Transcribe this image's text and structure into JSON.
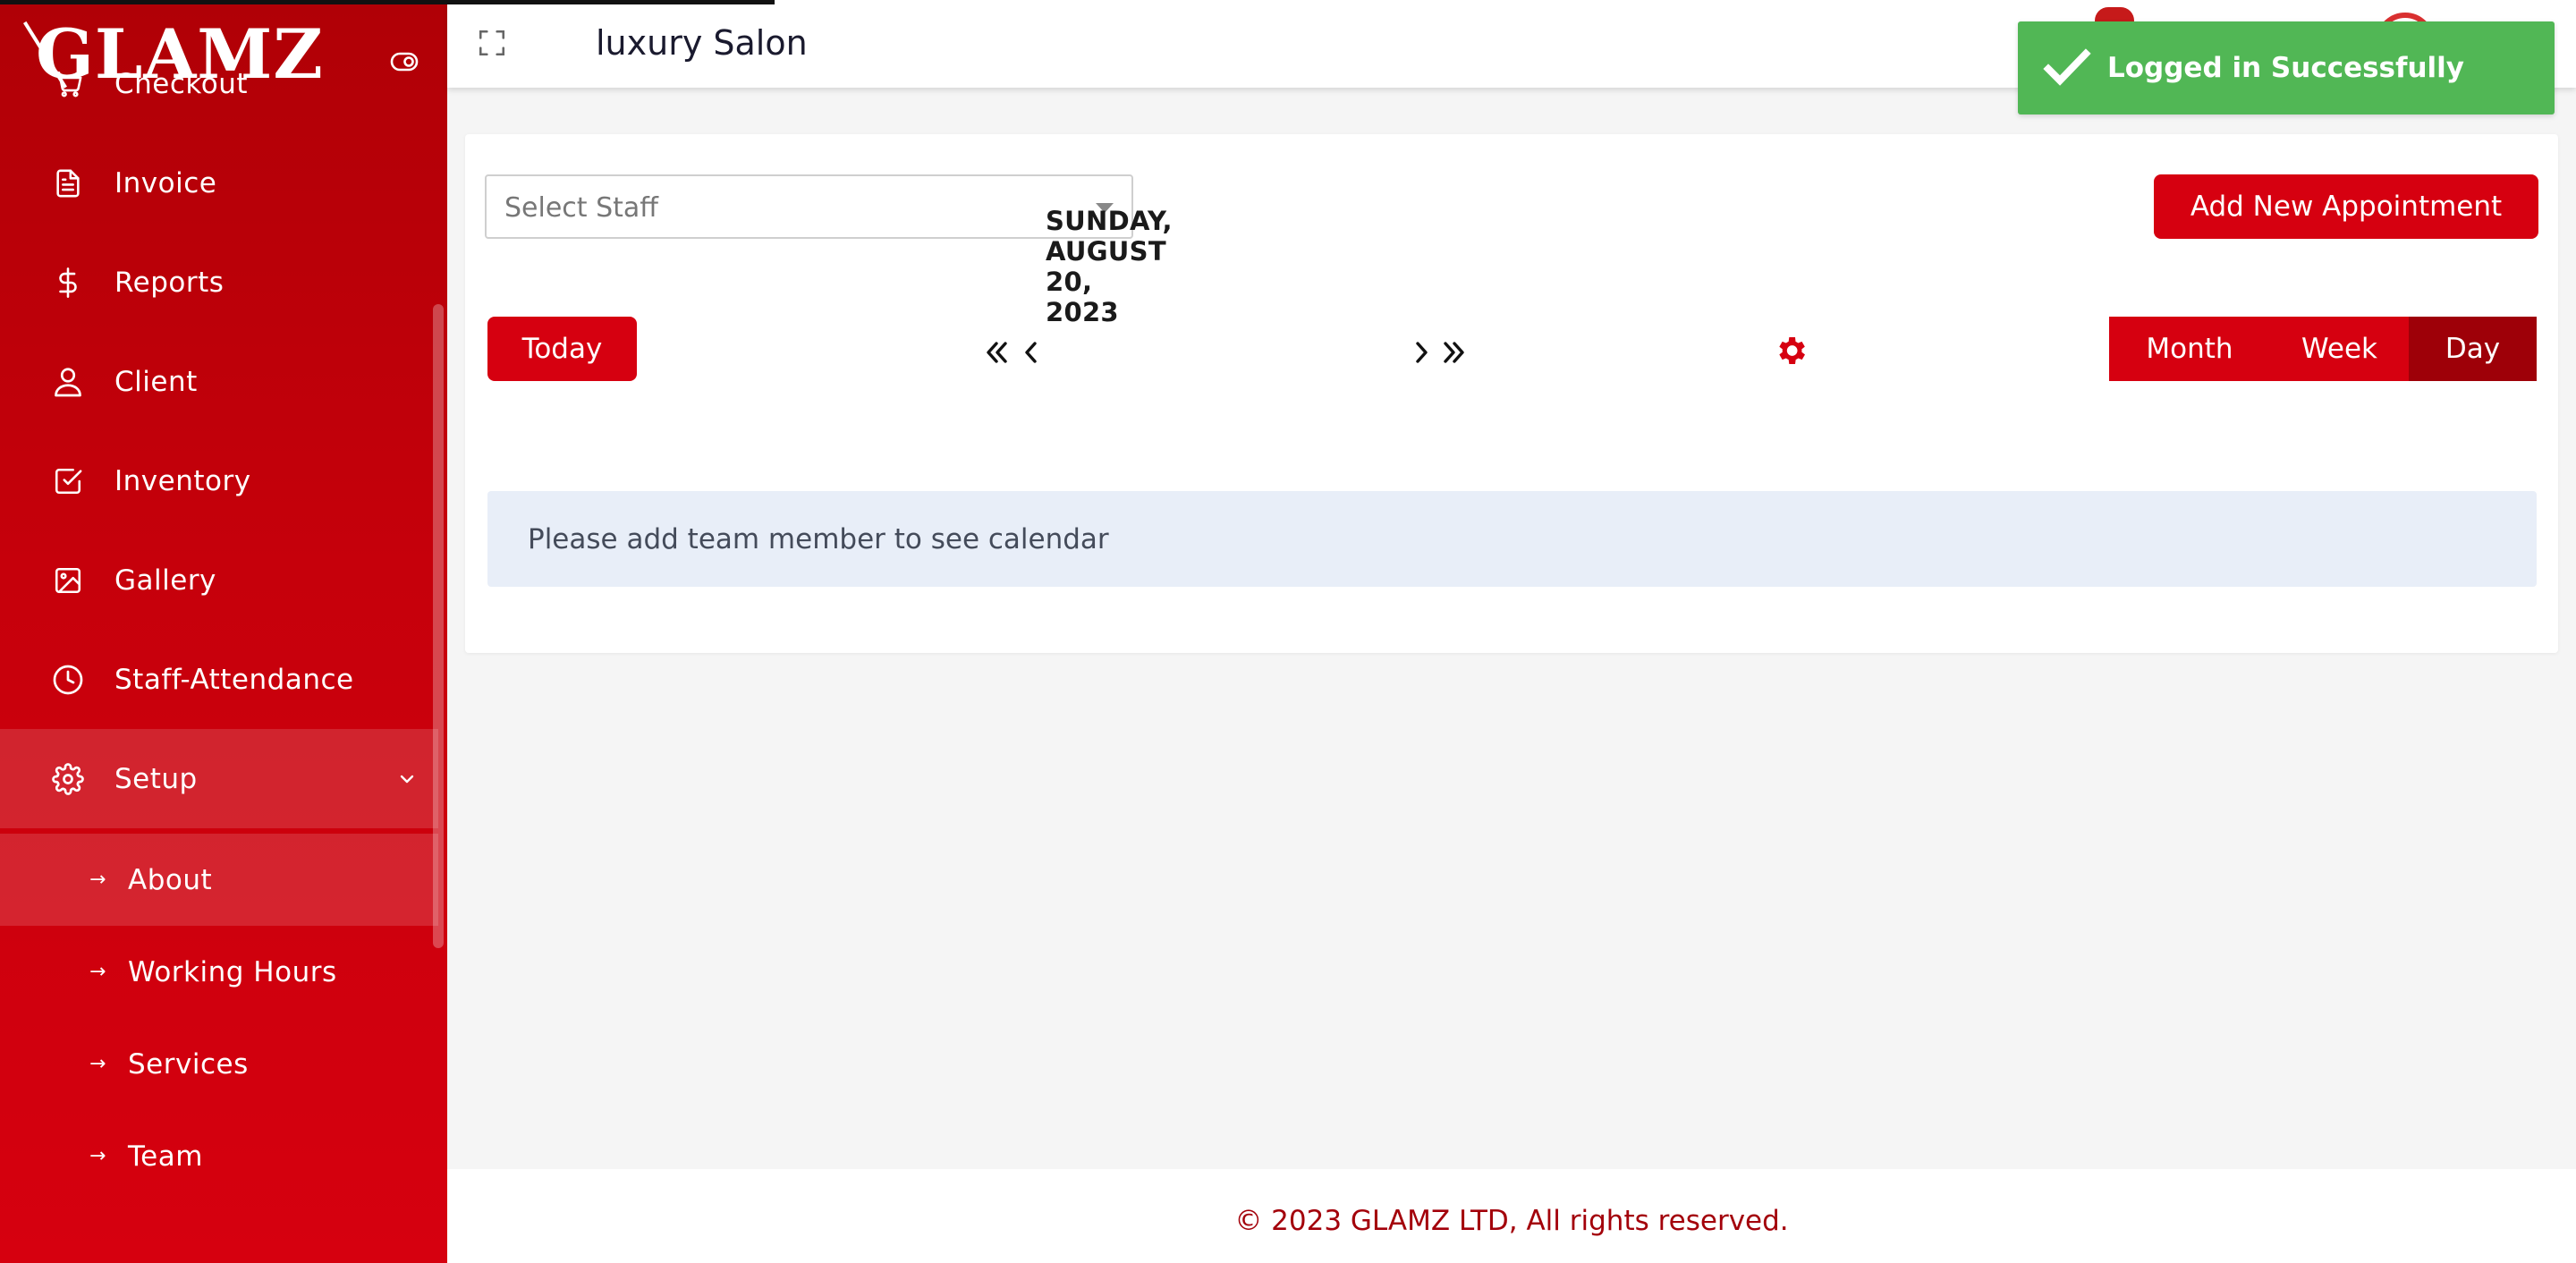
{
  "brand": {
    "logo_text": "GLAMZ"
  },
  "header": {
    "salon_name": "luxury Salon"
  },
  "toast": {
    "message": "Logged in Successfully"
  },
  "sidebar": {
    "items": [
      {
        "label": "Checkout",
        "icon": "cart-icon"
      },
      {
        "label": "Invoice",
        "icon": "document-icon"
      },
      {
        "label": "Reports",
        "icon": "dollar-icon"
      },
      {
        "label": "Client",
        "icon": "user-icon"
      },
      {
        "label": "Inventory",
        "icon": "checkbox-icon"
      },
      {
        "label": "Gallery",
        "icon": "image-icon"
      },
      {
        "label": "Staff-Attendance",
        "icon": "clock-icon"
      },
      {
        "label": "Setup",
        "icon": "gear-icon"
      }
    ],
    "sub_items": [
      {
        "label": "About"
      },
      {
        "label": "Working Hours"
      },
      {
        "label": "Services"
      },
      {
        "label": "Team"
      }
    ]
  },
  "toolbar": {
    "staff_placeholder": "Select Staff",
    "add_appointment_label": "Add New Appointment",
    "today_label": "Today",
    "current_date": "SUNDAY, AUGUST 20, 2023",
    "views": [
      {
        "label": "Month",
        "active": false
      },
      {
        "label": "Week",
        "active": false
      },
      {
        "label": "Day",
        "active": true
      }
    ]
  },
  "calendar": {
    "notice": "Please add team member to see calendar"
  },
  "footer": {
    "copyright": "© 2023 GLAMZ LTD, All rights reserved."
  },
  "colors": {
    "primary": "#d60010",
    "primary_dark": "#9e0008",
    "success": "#51b755",
    "notice_bg": "#e8eef8"
  }
}
